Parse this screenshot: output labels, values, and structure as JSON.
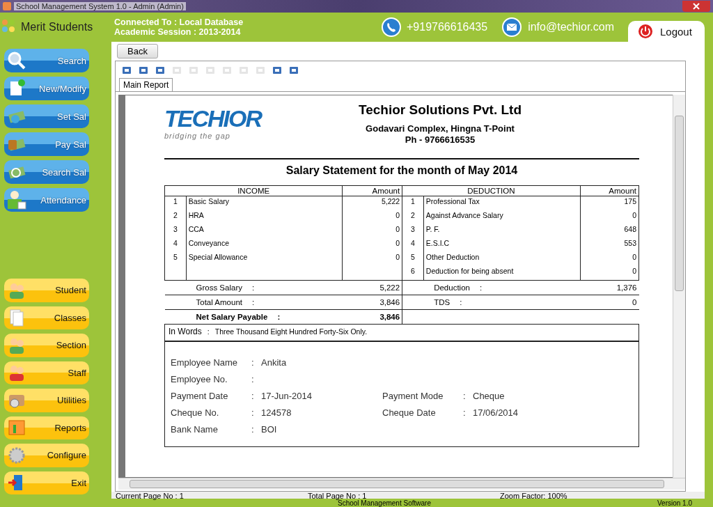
{
  "window": {
    "title": "School Management System 1.0  -  Admin (Admin)"
  },
  "header": {
    "app_name": "Merit Students",
    "connection": "Connected To : Local Database",
    "session": "Academic Session : 2013-2014",
    "phone": "+919766616435",
    "email": "info@techior.com",
    "logout": "Logout"
  },
  "sidebar": {
    "top_items": [
      {
        "label": "Search"
      },
      {
        "label": "New/Modify"
      },
      {
        "label": "Set Sal"
      },
      {
        "label": "Pay Sal"
      },
      {
        "label": "Search Sal"
      },
      {
        "label": "Attendance"
      }
    ],
    "bottom_items": [
      {
        "label": "Student"
      },
      {
        "label": "Classes"
      },
      {
        "label": "Section"
      },
      {
        "label": "Staff"
      },
      {
        "label": "Utilities"
      },
      {
        "label": "Reports"
      },
      {
        "label": "Configure"
      },
      {
        "label": "Exit"
      }
    ]
  },
  "back_button": "Back",
  "toolbar": [
    {
      "disabled": false
    },
    {
      "disabled": false
    },
    {
      "disabled": false
    },
    {
      "disabled": true
    },
    {
      "disabled": true
    },
    {
      "disabled": true
    },
    {
      "disabled": true
    },
    {
      "disabled": true
    },
    {
      "disabled": true
    },
    {
      "disabled": false
    },
    {
      "disabled": false
    }
  ],
  "report_tabs": [
    {
      "label": "Main Report",
      "selected": true
    }
  ],
  "report": {
    "logo_text": "TECHIOR",
    "logo_tagline": "bridging the gap",
    "company": "Techior Solutions Pvt. Ltd",
    "address": "Godavari Complex, Hingna T-Point",
    "phone": "Ph - 9766616535",
    "title": "Salary Statement for the month of May 2014",
    "sep": ":",
    "income_header": "INCOME",
    "income_amount_header": "Amount",
    "deduction_header": "DEDUCTION",
    "deduction_amount_header": "Amount",
    "income_rows": [
      {
        "no": "1",
        "label": "Basic Salary",
        "amount": "5,222"
      },
      {
        "no": "2",
        "label": "HRA",
        "amount": "0"
      },
      {
        "no": "3",
        "label": "CCA",
        "amount": "0"
      },
      {
        "no": "4",
        "label": "Conveyance",
        "amount": "0"
      },
      {
        "no": "5",
        "label": "Special Allowance",
        "amount": "0"
      }
    ],
    "deduction_rows": [
      {
        "no": "1",
        "label": "Professional Tax",
        "amount": "175"
      },
      {
        "no": "2",
        "label": "Against Advance Salary",
        "amount": "0"
      },
      {
        "no": "3",
        "label": "P. F.",
        "amount": "648"
      },
      {
        "no": "4",
        "label": "E.S.I.C",
        "amount": "553"
      },
      {
        "no": "5",
        "label": "Other Deduction",
        "amount": "0"
      },
      {
        "no": "6",
        "label": "Deduction for being absent",
        "amount": "0"
      }
    ],
    "summary": [
      {
        "kind": "normal",
        "left": {
          "label": "Gross Salary",
          "value": "5,222"
        },
        "right": {
          "label": "Deduction",
          "value": "1,376"
        }
      },
      {
        "kind": "normal",
        "left": {
          "label": "Total Amount",
          "value": "3,846"
        },
        "right": {
          "label": "TDS",
          "value": "0"
        }
      },
      {
        "kind": "net",
        "left": {
          "label": "Net Salary Payable",
          "value": "3,846"
        }
      }
    ],
    "in_words_label": "In Words",
    "in_words": "Three Thousand Eight Hundred Forty-Six Only.",
    "details": [
      {
        "fields": [
          {
            "label": "Employee Name",
            "value": "Ankita"
          }
        ]
      },
      {
        "fields": [
          {
            "label": "Employee No."
          }
        ]
      },
      {
        "fields": [
          {
            "label": "Payment Date",
            "value": "17-Jun-2014"
          },
          {
            "label": "Payment Mode",
            "value": "Cheque"
          }
        ]
      },
      {
        "fields": [
          {
            "label": "Cheque No.",
            "value": "124578"
          },
          {
            "label": "Cheque Date",
            "value": "17/06/2014"
          }
        ]
      },
      {
        "fields": [
          {
            "label": "Bank Name",
            "value": "BOI"
          }
        ]
      }
    ]
  },
  "status_bar": {
    "current_page": "Current Page No : 1",
    "total_pages": "Total Page No : 1",
    "zoom": "Zoom Factor: 100%"
  },
  "footer": {
    "product": "School Management Software",
    "version": "Version 1.0"
  }
}
